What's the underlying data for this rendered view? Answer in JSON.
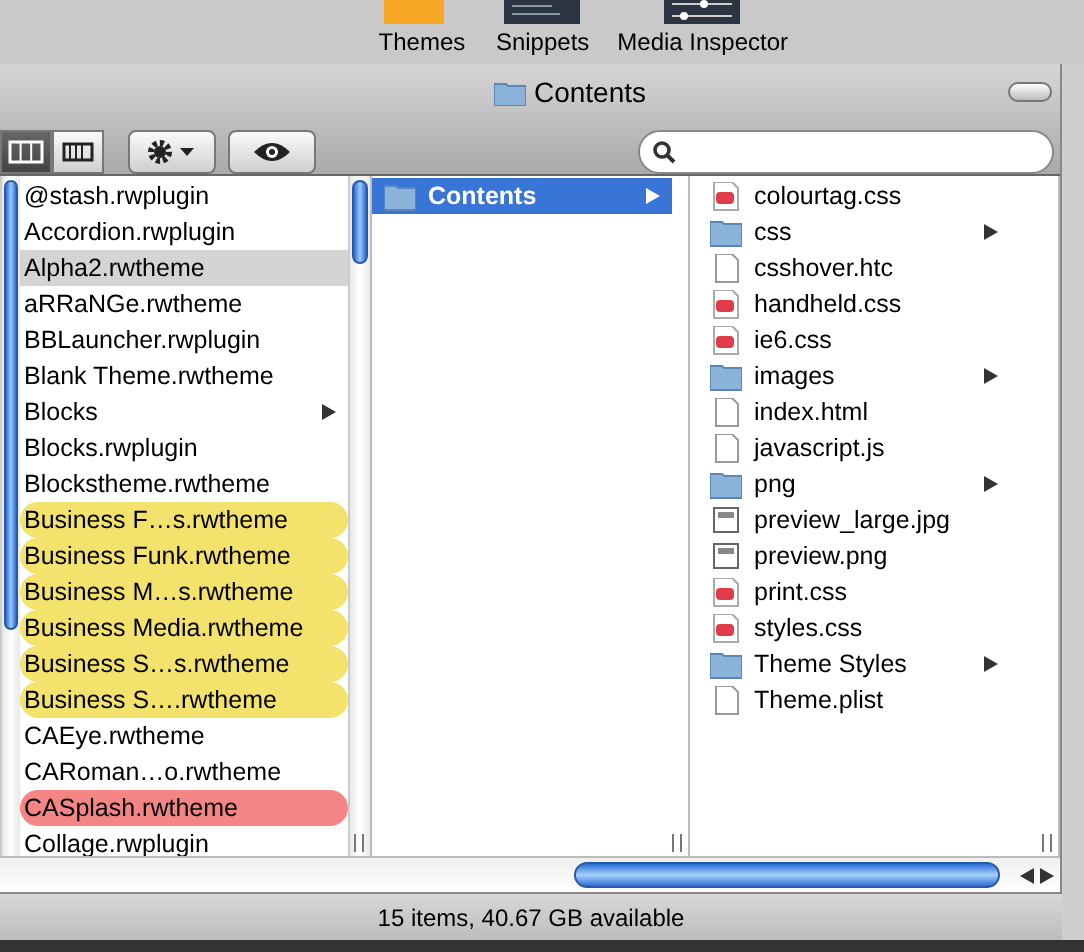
{
  "toolbar_apps": [
    {
      "label": "Themes",
      "kind": "themes"
    },
    {
      "label": "Snippets",
      "kind": "snippets"
    },
    {
      "label": "Media Inspector",
      "kind": "inspector"
    }
  ],
  "window": {
    "title": "Contents"
  },
  "toolbar": {
    "view_buttons": [
      {
        "kind": "columns",
        "selected": true
      },
      {
        "kind": "coverflow",
        "selected": false
      }
    ]
  },
  "columns": [
    {
      "items": [
        {
          "name": "@stash.rwplugin",
          "folder": false,
          "selected": false
        },
        {
          "name": "Accordion.rwplugin",
          "folder": false,
          "selected": false
        },
        {
          "name": "Alpha2.rwtheme",
          "folder": false,
          "selected": true
        },
        {
          "name": "aRRaNGe.rwtheme",
          "folder": false,
          "selected": false
        },
        {
          "name": "BBLauncher.rwplugin",
          "folder": false,
          "selected": false
        },
        {
          "name": "Blank Theme.rwtheme",
          "folder": false,
          "selected": false
        },
        {
          "name": "Blocks",
          "folder": true,
          "selected": false
        },
        {
          "name": "Blocks.rwplugin",
          "folder": false,
          "selected": false
        },
        {
          "name": "Blockstheme.rwtheme",
          "folder": false,
          "selected": false
        },
        {
          "name": "Business F…s.rwtheme",
          "folder": false,
          "selected": false,
          "color": "#f3e26c"
        },
        {
          "name": "Business Funk.rwtheme",
          "folder": false,
          "selected": false,
          "color": "#f3e26c"
        },
        {
          "name": "Business M…s.rwtheme",
          "folder": false,
          "selected": false,
          "color": "#f3e26c"
        },
        {
          "name": "Business Media.rwtheme",
          "folder": false,
          "selected": false,
          "color": "#f3e26c"
        },
        {
          "name": "Business S…s.rwtheme",
          "folder": false,
          "selected": false,
          "color": "#f3e26c"
        },
        {
          "name": "Business S….rwtheme",
          "folder": false,
          "selected": false,
          "color": "#f3e26c"
        },
        {
          "name": "CAEye.rwtheme",
          "folder": false,
          "selected": false
        },
        {
          "name": "CARoman…o.rwtheme",
          "folder": false,
          "selected": false
        },
        {
          "name": "CASplash.rwtheme",
          "folder": false,
          "selected": false,
          "color": "#f48585"
        },
        {
          "name": "Collage.rwplugin",
          "folder": false,
          "selected": false
        }
      ]
    },
    {
      "items": [
        {
          "name": "Contents",
          "kind": "folder",
          "folder": true,
          "selected": true
        }
      ]
    },
    {
      "items": [
        {
          "name": "colourtag.css",
          "kind": "css",
          "folder": false,
          "selected": false
        },
        {
          "name": "css",
          "kind": "folder",
          "folder": true,
          "selected": false
        },
        {
          "name": "csshover.htc",
          "kind": "document",
          "folder": false,
          "selected": false
        },
        {
          "name": "handheld.css",
          "kind": "css",
          "folder": false,
          "selected": false
        },
        {
          "name": "ie6.css",
          "kind": "css",
          "folder": false,
          "selected": false
        },
        {
          "name": "images",
          "kind": "folder",
          "folder": true,
          "selected": false
        },
        {
          "name": "index.html",
          "kind": "document",
          "folder": false,
          "selected": false
        },
        {
          "name": "javascript.js",
          "kind": "document",
          "folder": false,
          "selected": false
        },
        {
          "name": "png",
          "kind": "folder",
          "folder": true,
          "selected": false
        },
        {
          "name": "preview_large.jpg",
          "kind": "image",
          "folder": false,
          "selected": false
        },
        {
          "name": "preview.png",
          "kind": "image",
          "folder": false,
          "selected": false
        },
        {
          "name": "print.css",
          "kind": "css",
          "folder": false,
          "selected": false
        },
        {
          "name": "styles.css",
          "kind": "css",
          "folder": false,
          "selected": false
        },
        {
          "name": "Theme Styles",
          "kind": "folder",
          "folder": true,
          "selected": false
        },
        {
          "name": "Theme.plist",
          "kind": "document",
          "folder": false,
          "selected": false
        }
      ]
    }
  ],
  "status_bar": "15 items, 40.67 GB available"
}
